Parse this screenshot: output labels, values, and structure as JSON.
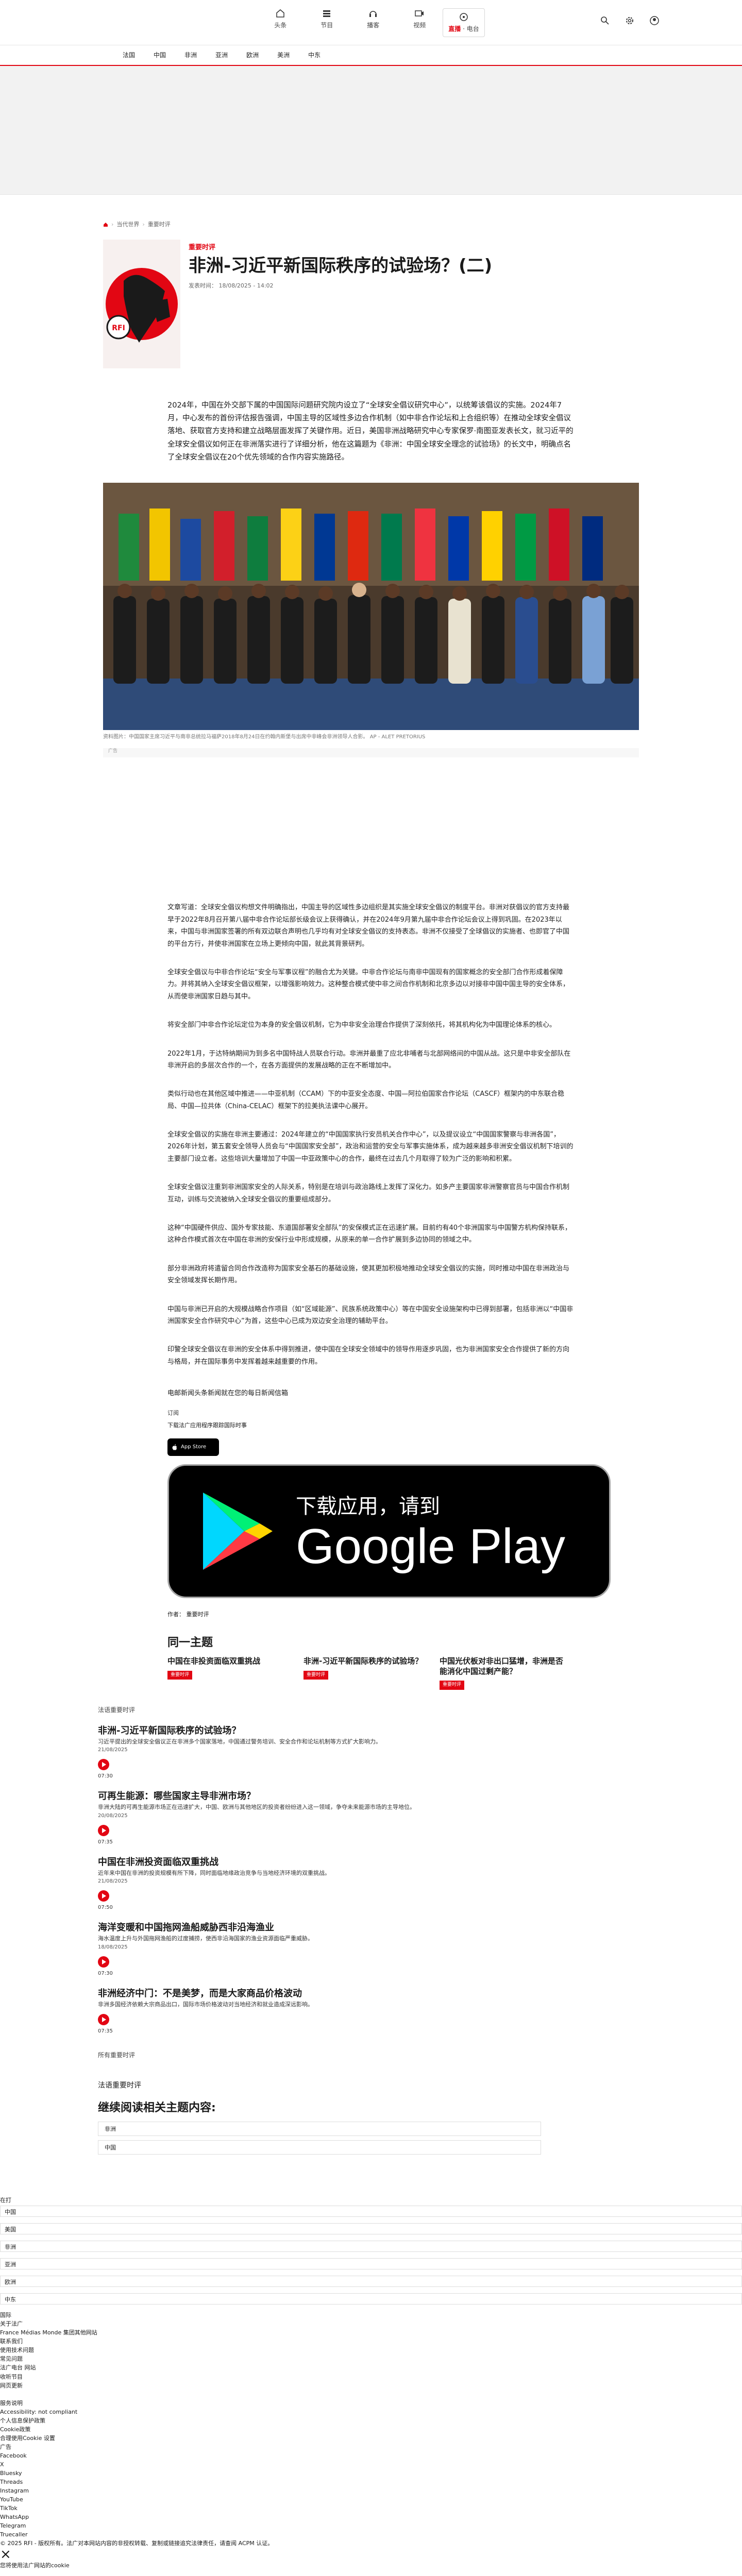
{
  "nav": {
    "home": "头条",
    "episodes": "节目",
    "podcasts": "播客",
    "videos": "视频",
    "live_prefix": "直播",
    "live_label": "电台"
  },
  "subnav": [
    "法国",
    "中国",
    "非洲",
    "亚洲",
    "欧洲",
    "美洲",
    "中东"
  ],
  "crumb": [
    "当代世界",
    "重要时评"
  ],
  "article": {
    "kicker": "重要时评",
    "title": "非洲-习近平新国际秩序的试验场？(二)",
    "meta": "发表时间：  18/08/2025 - 14:02",
    "lead": "2024年，中国在外交部下属的中国国际问题研究院内设立了“全球安全倡议研究中心”，以统筹该倡议的实施。2024年7月，中心发布的首份评估报告强调，中国主导的区域性多边合作机制（如中非合作论坛和上合组织等）在推动全球安全倡议落地、获取官方支持和建立战略层面发挥了关键作用。近日，美国非洲战略研究中心专家保罗·南图亚发表长文，就习近平的全球安全倡议如何正在非洲落实进行了详细分析，他在这篇题为《非洲：中国全球安全理念的试验场》的长文中，明确点名了全球安全倡议在20个优先领域的合作内容实施路径。",
    "photo_caption": "资料图片：中国国家主席习近平与南非总统拉马福萨2018年8月24日在约翰内斯堡与出席中非峰会非洲领导人合影。 AP - ALET PRETORIUS",
    "ad_label": "广告",
    "paragraphs": [
      "文章写道：全球安全倡议构想文件明确指出，中国主导的区域性多边组织是其实施全球安全倡议的制度平台。非洲对获倡议的官方支持最早于2022年8月召开第八届中非合作论坛部长级会议上获得确认，并在2024年9月第九届中非合作论坛会议上得到巩固。在2023年以来，中国与非洲国家签署的所有双边联合声明也几乎均有对全球安全倡议的支持表态。非洲不仅接受了全球倡议的实施者、也即官了中国的平台方行，并使非洲国家在立场上更倾向中国，就此其背景研判。",
      "全球安全倡议与中非合作论坛“安全与军事议程”的融合尤为关键。中非合作论坛与南非中国现有的国家概念的安全部门合作形成着保障力。并将其纳入全球安全倡议框架，以增强影响效力。这种整合模式使中非之间合作机制和北京多边以对接非中国中国主导的安全体系，从而使非洲国家日趋与其中。",
      "将安全部门中非合作论坛定位为本身的安全倡议机制，它为中非安全治理合作提供了深刻依托，将其机构化为中国理论体系的核心。",
      "2022年1月，于达特纳期间为到多名中国特战人员联合行动。非洲并最重了应北非哺者与北部网络间的中国从战。这只是中非安全部队在非洲开启的多层次合作的一个，在各方面提供的发展战略的正在不断增加中。",
      "类似行动也在其他区域中推进——中亚机制（CCAM）下的中亚安全态度、中国—阿拉伯国家合作论坛（CASCF）框架内的中东联合稳局、中国—拉共体（China-CELAC）框架下的拉美执法课中心展开。",
      "全球安全倡议的实施在非洲主要通过：2024年建立的“中国国家执行安员机关合作中心”，以及提议设立“中国国家警察与非洲各国”，2026年计划，第五套安全领导人员会与“中国国家安全部”，政治和运营的安全与军事实施体系，成为越来越多非洲安全倡议机制下培训的主要部门设立者。这些培训大量增加了中国一中亚政策中心的合作，最终在过去几个月取得了较为广泛的影响和积累。",
      "全球安全倡议注重到非洲国家安全的人际关系，特别是在培训与政治路线上发挥了深化力。如多产主要国家非洲警察官员与中国合作机制互动，训练与交流被纳入全球安全倡议的重要组成部分。",
      "这种“中国硬件供应、国外专家技能、东道国部署安全部队”的安保模式正在迅速扩展。目前约有40个非洲国家与中国警方机构保持联系，这种合作模式首次在中国在非洲的安保行业中形成规模，从原来的单一合作扩展到多边协同的领域之中。",
      "部分非洲政府将遣留合同合作改造称为国家安全基石的基础设施，使其更加积极地推动全球安全倡议的实施，同时推动中国在非洲政治与安全领域发挥长期作用。",
      "中国与非洲已开启的大规模战略合作项目（如“区域能源”、民族系统政策中心）等在中国安全设施架构中已得到部署，包括非洲以“中国非洲国家安全合作研究中心”为首，这些中心已成为双边安全治理的辅助平台。",
      "印警全球安全倡议在非洲的安全体系中得到推进，使中国在全球安全领域中的领导作用逐步巩固，也为非洲国家安全合作提供了新的方向与格局，并在国际事务中发挥着越来越重要的作用。"
    ],
    "newsletter": "电邮新闻头条新闻就在您的每日新闻信箱",
    "share_label": "订阅",
    "download": "下载法广应用程序跟踪国际时事",
    "appstore": "App Store",
    "googleplay_prefix": "下载应用，请到",
    "googleplay": "Google Play",
    "author": "作者：  重要时评"
  },
  "same_topic": {
    "title": "同一主题",
    "cards": [
      {
        "title": "中国在非投资面临双重挑战",
        "badge": "重要时评"
      },
      {
        "title": "非洲-习近平新国际秩序的试验场？",
        "badge": "重要时评"
      },
      {
        "title": "中国光伏板对非出口猛增，非洲是否能消化中国过剩产能？",
        "badge": "重要时评"
      }
    ]
  },
  "list": {
    "section": "法语重要时评",
    "items": [
      {
        "title": "非洲-习近平新国际秩序的试验场？",
        "desc": "习近平提出的全球安全倡议正在非洲多个国家落地，中国通过警务培训、安全合作和论坛机制等方式扩大影响力。",
        "date": "21/08/2025",
        "dur": "07:30"
      },
      {
        "title": "可再生能源：哪些国家主导非洲市场？",
        "desc": "非洲大陆的可再生能源市场正在迅速扩大，中国、欧洲与其他地区的投资者纷纷进入这一领域，争夺未来能源市场的主导地位。",
        "date": "20/08/2025",
        "dur": "07:35"
      },
      {
        "title": "中国在非洲投资面临双重挑战",
        "desc": "近年来中国在非洲的投资规模有所下降，同时面临地缘政治竞争与当地经济环境的双重挑战。",
        "date": "21/08/2025",
        "dur": "07:50"
      },
      {
        "title": "海洋变暖和中国拖网渔船威胁西非沿海渔业",
        "desc": "海水温度上升与外国拖网渔船的过度捕捞，使西非沿海国家的渔业资源面临严重威胁。",
        "date": "18/08/2025",
        "dur": "07:30"
      },
      {
        "title": "非洲经济中门：不是美梦，而是大家商品价格波动",
        "desc": "非洲多国经济依赖大宗商品出口，国际市场价格波动对当地经济和就业造成深远影响。",
        "date": "",
        "dur": "07:35"
      }
    ],
    "more": "所有重要时评"
  },
  "keep_reading": {
    "label": "法语重要时评",
    "title": "继续阅读相关主题内容:",
    "rows": [
      "非洲",
      "中国"
    ]
  },
  "footer": {
    "sections": [
      {
        "head": "在打",
        "row": "中国"
      },
      {
        "head": "",
        "row": "美国"
      },
      {
        "head": "",
        "row": "非洲"
      },
      {
        "head": "",
        "row": "亚洲"
      },
      {
        "head": "",
        "row": "欧洲"
      },
      {
        "head": "",
        "row": "中东"
      }
    ],
    "links": [
      "国际",
      "关于法广",
      "France Médias Monde 集团其他网站",
      "联系我们",
      "使用技术问题",
      "常见问题",
      "法广电台 网站",
      "收听节目",
      "网页更新"
    ],
    "legal": [
      "服务说明",
      "Accessibility: not compliant",
      "个人信息保护政策",
      "Cookie政策",
      "合理使用Cookie 设置",
      "广告",
      "Facebook",
      "X",
      "Bluesky",
      "Threads",
      "Instagram",
      "YouTube",
      "TikTok",
      "WhatsApp",
      "Telegram",
      "Truecaller"
    ],
    "copyright": "© 2025 RFI - 版权所有。法广对本网站内容的非授权转载、复制或链接追究法律责任，请查阅 ACPM 认证。",
    "close": "×",
    "notice": "您将使用法广网站的cookie"
  }
}
